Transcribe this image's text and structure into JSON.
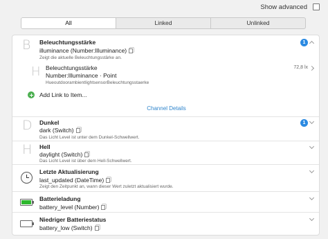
{
  "header": {
    "show_advanced_label": "Show advanced",
    "show_advanced_checked": false
  },
  "tabs": [
    {
      "label": "All",
      "active": true
    },
    {
      "label": "Linked",
      "active": false
    },
    {
      "label": "Unlinked",
      "active": false
    }
  ],
  "channels": {
    "illuminance": {
      "letter": "B",
      "title": "Beleuchtungsstärke",
      "type": "illuminance (Number:Illuminance)",
      "description": "Zeigt die aktuelle Beleuchtungsstärke an.",
      "badge": "1",
      "link": {
        "letter": "H",
        "title": "Beleuchtungsstärke",
        "type": "Number:Illuminance · Point",
        "item_name": "HueoutdoorambientlightsensorBeleuchtungsstaerke",
        "value": "72,8 lx"
      },
      "add_link_label": "Add Link to Item..."
    },
    "details_label": "Channel Details",
    "dark": {
      "letter": "D",
      "title": "Dunkel",
      "type": "dark (Switch)",
      "description": "Das Licht Level ist unter dem Dunkel-Schwellwert.",
      "badge": "1"
    },
    "daylight": {
      "letter": "H",
      "title": "Hell",
      "type": "daylight (Switch)",
      "description": "Das Licht Level ist über dem Hell-Schwellwert."
    },
    "last_updated": {
      "icon": "clock-icon",
      "title": "Letzte Aktualisierung",
      "type": "last_updated (DateTime)",
      "description": "Zeigt den Zeitpunkt an, wann dieser Wert zuletzt aktualisiert wurde."
    },
    "battery_level": {
      "icon": "battery-full-icon",
      "title": "Batterieladung",
      "type": "battery_level (Number)",
      "level": 1.0,
      "color": "#2eb82e"
    },
    "battery_low": {
      "icon": "battery-empty-icon",
      "title": "Niedriger Batteriestatus",
      "type": "battery_low (Switch)",
      "level": 0.0
    }
  },
  "colors": {
    "accent": "#2b8ae2",
    "add_link": "#4caf50",
    "battery_full": "#2eb82e"
  }
}
